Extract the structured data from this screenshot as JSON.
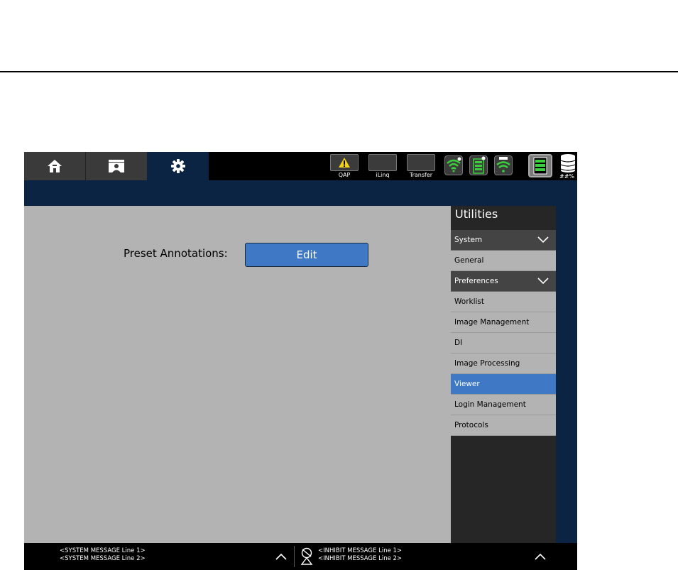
{
  "tabs": {
    "home": "home-icon",
    "patient": "patient-folder-icon",
    "settings": "gear-icon"
  },
  "status": {
    "qap_label": "QAP",
    "iling_label": "iLinq",
    "transfer_label": "Transfer",
    "storage_label": "##%"
  },
  "main": {
    "preset_label": "Preset Annotations:",
    "edit_label": "Edit"
  },
  "nav": {
    "title": "Utilities",
    "system_header": "System",
    "general": "General",
    "preferences_header": "Preferences",
    "items": [
      "Worklist",
      "Image Management",
      "DI",
      "Image Processing",
      "Viewer",
      "Login Management",
      "Protocols"
    ],
    "selected": "Viewer"
  },
  "messages": {
    "system_line1": "<SYSTEM MESSAGE Line 1>",
    "system_line2": "<SYSTEM MESSAGE Line 2>",
    "inhibit_line1": "<INHIBIT MESSAGE Line 1>",
    "inhibit_line2": "<INHIBIT MESSAGE Line 2>"
  },
  "colors": {
    "accent": "#3f78c4",
    "navy": "#0c2444",
    "panel": "#b3b3b3"
  }
}
